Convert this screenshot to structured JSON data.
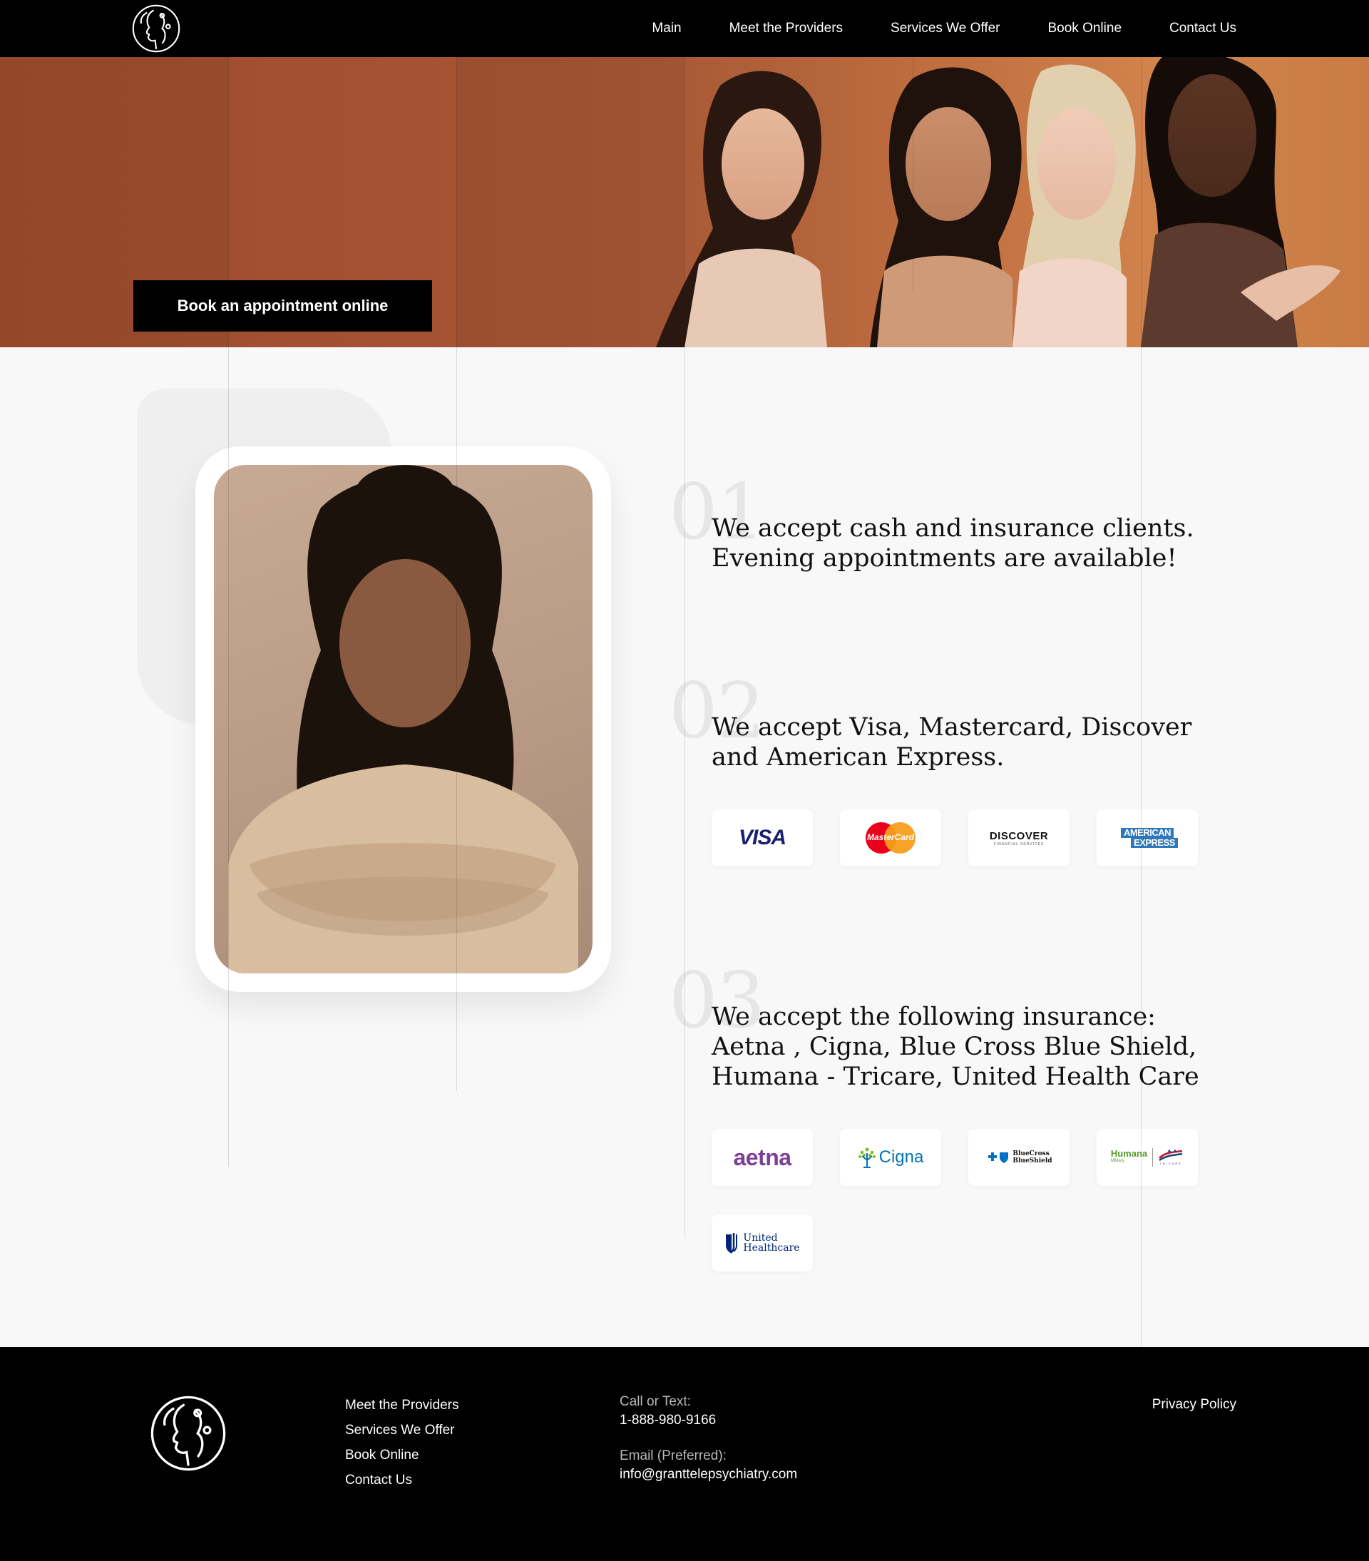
{
  "nav": {
    "items": [
      {
        "label": "Main"
      },
      {
        "label": "Meet the Providers"
      },
      {
        "label": "Services We Offer"
      },
      {
        "label": "Book Online"
      },
      {
        "label": "Contact Us"
      }
    ]
  },
  "hero": {
    "cta_label": "Book an appointment online"
  },
  "steps": [
    {
      "number": "01",
      "text": "We accept cash and insurance clients. Evening appointments are available!"
    },
    {
      "number": "02",
      "text": "We accept Visa, Mastercard, Discover and American Express."
    },
    {
      "number": "03",
      "text": "We accept the following insurance: Aetna , Cigna, Blue Cross Blue Shield, Humana - Tricare, United Health Care"
    }
  ],
  "payment_logos": {
    "visa": "VISA",
    "mastercard": "MasterCard",
    "discover": "DISCOVER",
    "discover_sub": "FINANCIAL SERVICES",
    "amex_line1": "AMERICAN",
    "amex_line2": "EXPRESS"
  },
  "insurance_logos": {
    "aetna": "aetna",
    "cigna": "Cigna",
    "bcbs_line1": "BlueCross",
    "bcbs_line2": "BlueShield",
    "humana": "Humana",
    "humana_sub": "Military",
    "tricare": "TRICARE",
    "uhc_line1": "United",
    "uhc_line2": "Healthcare"
  },
  "footer": {
    "links": [
      {
        "label": "Meet the Providers"
      },
      {
        "label": "Services We Offer"
      },
      {
        "label": "Book Online"
      },
      {
        "label": "Contact Us"
      }
    ],
    "call_label": "Call or Text:",
    "phone": "1-888-980-9166",
    "email_label": "Email (Preferred):",
    "email": "info@granttelepsychiatry.com",
    "privacy": "Privacy Policy"
  },
  "colors": {
    "header_bg": "#000000",
    "hero_brown": "#a45231",
    "hero_orange": "#d2844d",
    "page_bg": "#f8f8f8",
    "visa_blue": "#1a1f71",
    "aetna_purple": "#7d3f98",
    "cigna_blue": "#0073b6",
    "bcbs_blue": "#0072c6",
    "humana_green": "#78be20",
    "uhc_navy": "#002677"
  }
}
